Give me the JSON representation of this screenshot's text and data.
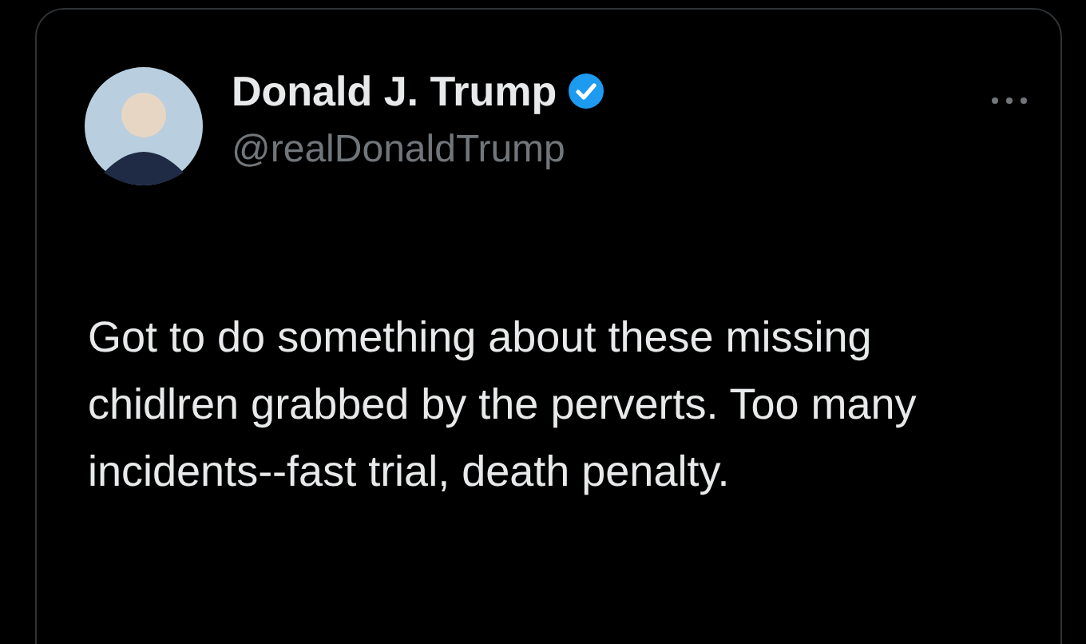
{
  "author": {
    "name": "Donald J. Trump",
    "verified": true,
    "handle": "@realDonaldTrump"
  },
  "tweet": {
    "text": "Got to do something about these missing chidlren grabbed by the perverts. Too many incidents--fast trial, death penalty."
  }
}
